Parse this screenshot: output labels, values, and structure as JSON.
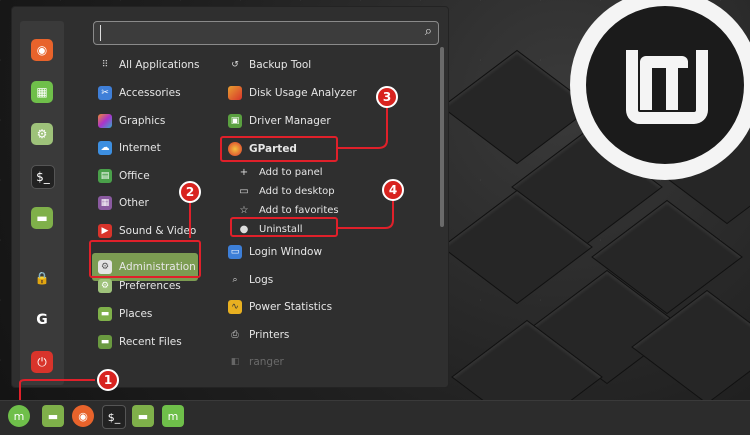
{
  "search": {
    "placeholder": ""
  },
  "categories": [
    {
      "label": "All Applications"
    },
    {
      "label": "Accessories"
    },
    {
      "label": "Graphics"
    },
    {
      "label": "Internet"
    },
    {
      "label": "Office"
    },
    {
      "label": "Other"
    },
    {
      "label": "Sound & Video"
    },
    {
      "label": "Administration"
    },
    {
      "label": "Preferences"
    },
    {
      "label": "Places"
    },
    {
      "label": "Recent Files"
    }
  ],
  "apps": [
    {
      "label": "Backup Tool"
    },
    {
      "label": "Disk Usage Analyzer"
    },
    {
      "label": "Driver Manager"
    },
    {
      "label": "GParted"
    },
    {
      "label": "Login Window"
    },
    {
      "label": "Logs"
    },
    {
      "label": "Power Statistics"
    },
    {
      "label": "Printers"
    },
    {
      "label": "ranger"
    }
  ],
  "context_menu": [
    {
      "label": "Add to panel",
      "icon": "+"
    },
    {
      "label": "Add to desktop",
      "icon": "▭"
    },
    {
      "label": "Add to favorites",
      "icon": "☆"
    },
    {
      "label": "Uninstall",
      "icon": "●"
    }
  ],
  "badges": [
    "1",
    "2",
    "3",
    "4"
  ],
  "colors": {
    "accent": "#7c9c52",
    "highlight": "#e0202a"
  }
}
